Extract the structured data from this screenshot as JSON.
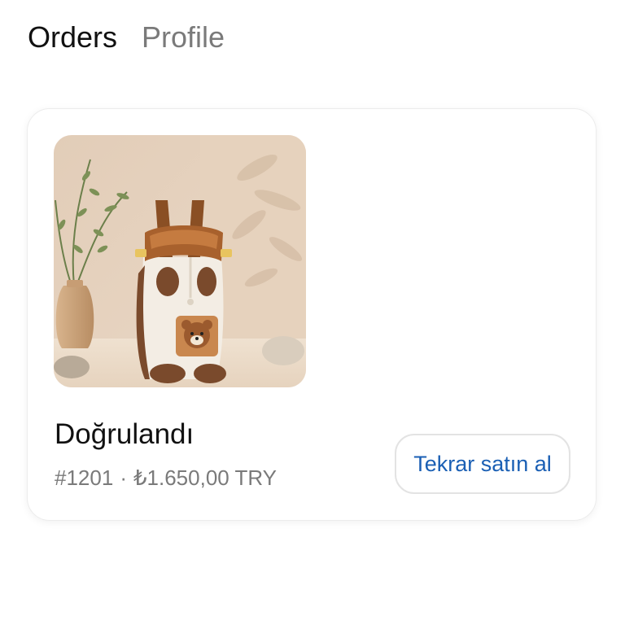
{
  "tabs": [
    {
      "label": "Orders",
      "active": true
    },
    {
      "label": "Profile",
      "active": false
    }
  ],
  "order": {
    "status": "Doğrulandı",
    "number": "#1201",
    "separator": "·",
    "price": "₺1.650,00 TRY",
    "rebuy_label": "Tekrar satın al",
    "image_icon": "pet-carrier-backpack-image"
  },
  "colors": {
    "accent": "#1a5fb4",
    "text_primary": "#111111",
    "text_secondary": "#7a7a7a"
  }
}
